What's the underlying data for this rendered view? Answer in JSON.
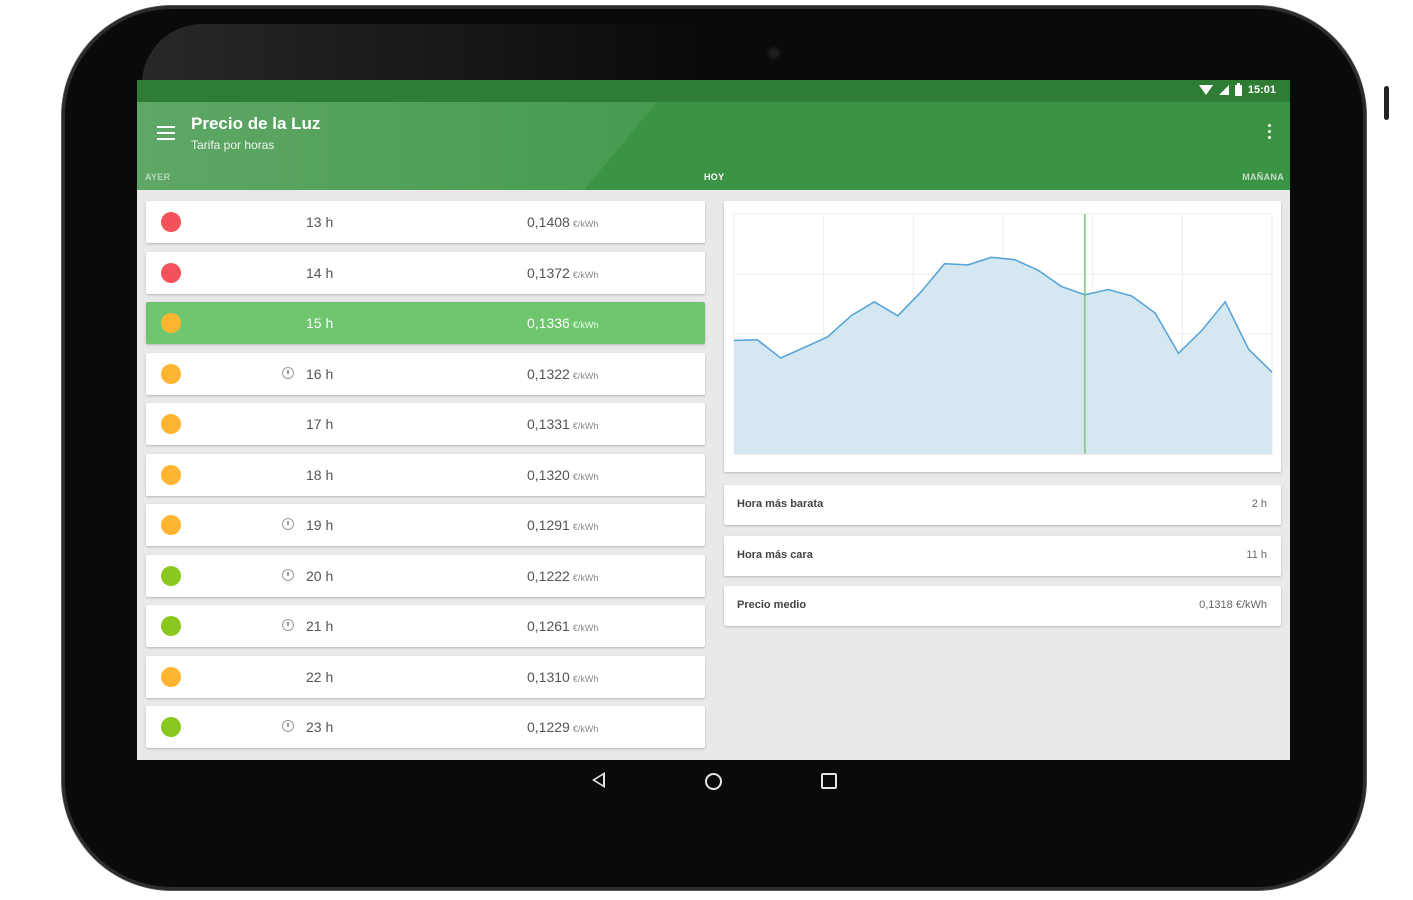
{
  "status_bar": {
    "time": "15:01"
  },
  "app_bar": {
    "title": "Precio de la Luz",
    "subtitle": "Tarifa por horas",
    "tabs": [
      "AYER",
      "HOY",
      "MAÑANA"
    ],
    "selected_tab": "HOY",
    "color": "#3b9444"
  },
  "prices": [
    {
      "hour": "13 h",
      "price": "0,1408",
      "unit": "€/kWh",
      "level": "red",
      "alarm": false,
      "active": false
    },
    {
      "hour": "14 h",
      "price": "0,1372",
      "unit": "€/kWh",
      "level": "red",
      "alarm": false,
      "active": false
    },
    {
      "hour": "15 h",
      "price": "0,1336",
      "unit": "€/kWh",
      "level": "orange",
      "alarm": false,
      "active": true
    },
    {
      "hour": "16 h",
      "price": "0,1322",
      "unit": "€/kWh",
      "level": "orange",
      "alarm": true,
      "active": false
    },
    {
      "hour": "17 h",
      "price": "0,1331",
      "unit": "€/kWh",
      "level": "orange",
      "alarm": false,
      "active": false
    },
    {
      "hour": "18 h",
      "price": "0,1320",
      "unit": "€/kWh",
      "level": "orange",
      "alarm": false,
      "active": false
    },
    {
      "hour": "19 h",
      "price": "0,1291",
      "unit": "€/kWh",
      "level": "orange",
      "alarm": true,
      "active": false
    },
    {
      "hour": "20 h",
      "price": "0,1222",
      "unit": "€/kWh",
      "level": "green",
      "alarm": true,
      "active": false
    },
    {
      "hour": "21 h",
      "price": "0,1261",
      "unit": "€/kWh",
      "level": "green",
      "alarm": true,
      "active": false
    },
    {
      "hour": "22 h",
      "price": "0,1310",
      "unit": "€/kWh",
      "level": "orange",
      "alarm": false,
      "active": false
    },
    {
      "hour": "23 h",
      "price": "0,1229",
      "unit": "€/kWh",
      "level": "green",
      "alarm": true,
      "active": false
    }
  ],
  "level_colors": {
    "red": "#f4525a",
    "orange": "#ffb531",
    "green": "#8bc81f"
  },
  "chart_data": {
    "type": "area",
    "x": [
      0,
      1,
      2,
      3,
      4,
      5,
      6,
      7,
      8,
      9,
      10,
      11,
      12,
      13,
      14,
      15,
      16,
      17,
      18,
      19,
      20,
      21,
      22,
      23
    ],
    "values": [
      0.1244,
      0.1245,
      0.1214,
      0.1232,
      0.125,
      0.1286,
      0.131,
      0.1286,
      0.1327,
      0.1375,
      0.1373,
      0.1386,
      0.1382,
      0.1364,
      0.1336,
      0.1322,
      0.1331,
      0.132,
      0.1291,
      0.1222,
      0.1261,
      0.131,
      0.1229,
      0.119
    ],
    "ylim": [
      0.105,
      0.146
    ],
    "highlight_x": 15,
    "fill_color": "#d5e8f2",
    "line_color": "#5aa5d8",
    "marker_color": "#7cc67c",
    "grid": true
  },
  "summary": [
    {
      "label": "Hora más barata",
      "value": "2 h"
    },
    {
      "label": "Hora más cara",
      "value": "11 h"
    },
    {
      "label": "Precio medio",
      "value": "0,1318 €/kWh"
    }
  ]
}
